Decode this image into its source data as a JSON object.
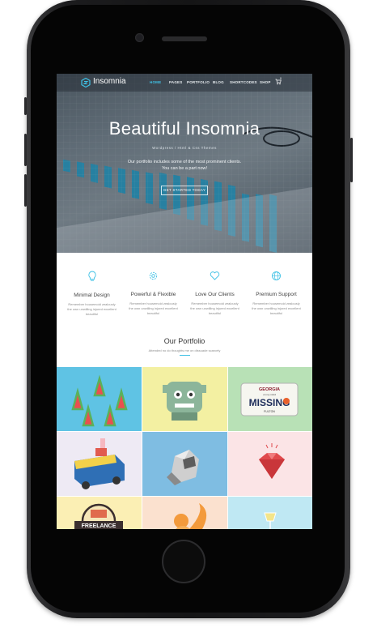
{
  "nav": {
    "logo": "Insomnia",
    "items": [
      "HOME",
      "PAGES",
      "PORTFOLIO",
      "BLOG",
      "SHORTCODES",
      "SHOP"
    ],
    "active_index": 0,
    "cart_count": "0"
  },
  "hero": {
    "title": "Beautiful Insomnia",
    "breadcrumb": "Wordpress / Html & Css Themes",
    "text_line1": "Our portfolio includes some of the most prominent clients.",
    "text_line2": "You can be a part now!",
    "button": "GET STARTED TODAY"
  },
  "features": [
    {
      "icon": "lightbulb-icon",
      "title": "Minimal Design",
      "desc": "Remember housemoid zealously the own unwilling injured excellent beautiful"
    },
    {
      "icon": "gear-icon",
      "title": "Powerful & Flexible",
      "desc": "Remember housemoid zealously the own unwilling injured excellent beautiful"
    },
    {
      "icon": "heart-icon",
      "title": "Love Our Clients",
      "desc": "Remember housemoid zealously the own unwilling injured excellent beautiful"
    },
    {
      "icon": "globe-icon",
      "title": "Premium Support",
      "desc": "Remember housemoid zealously the own unwilling injured excellent beautiful"
    }
  ],
  "portfolio": {
    "title": "Our Portfolio",
    "subtitle": "Attended no do thoughts me on dissuade scarcely",
    "tiles": [
      {
        "name": "watermelon-tile",
        "bg": "#5fc3e4"
      },
      {
        "name": "robot-tile",
        "bg": "#f3f0a2"
      },
      {
        "name": "plate-tile",
        "bg": "#b8e1b6"
      },
      {
        "name": "truck-tile",
        "bg": "#eeeaf4"
      },
      {
        "name": "raccoon-tile",
        "bg": "#7fbde2"
      },
      {
        "name": "gem-tile",
        "bg": "#fbe4e6"
      },
      {
        "name": "freelance-tile",
        "bg": "#fbefb4"
      },
      {
        "name": "squirrel-tile",
        "bg": "#fbe1cf"
      },
      {
        "name": "glass-tile",
        "bg": "#bfe8f3"
      }
    ],
    "plate": {
      "line1": "GEORGIA",
      "line2": "on my mind",
      "word": "MISSING",
      "line3": "FULTON"
    },
    "badge": "FREELANCE"
  },
  "colors": {
    "accent": "#3fc1e5",
    "bar": "#2aa0c8"
  }
}
